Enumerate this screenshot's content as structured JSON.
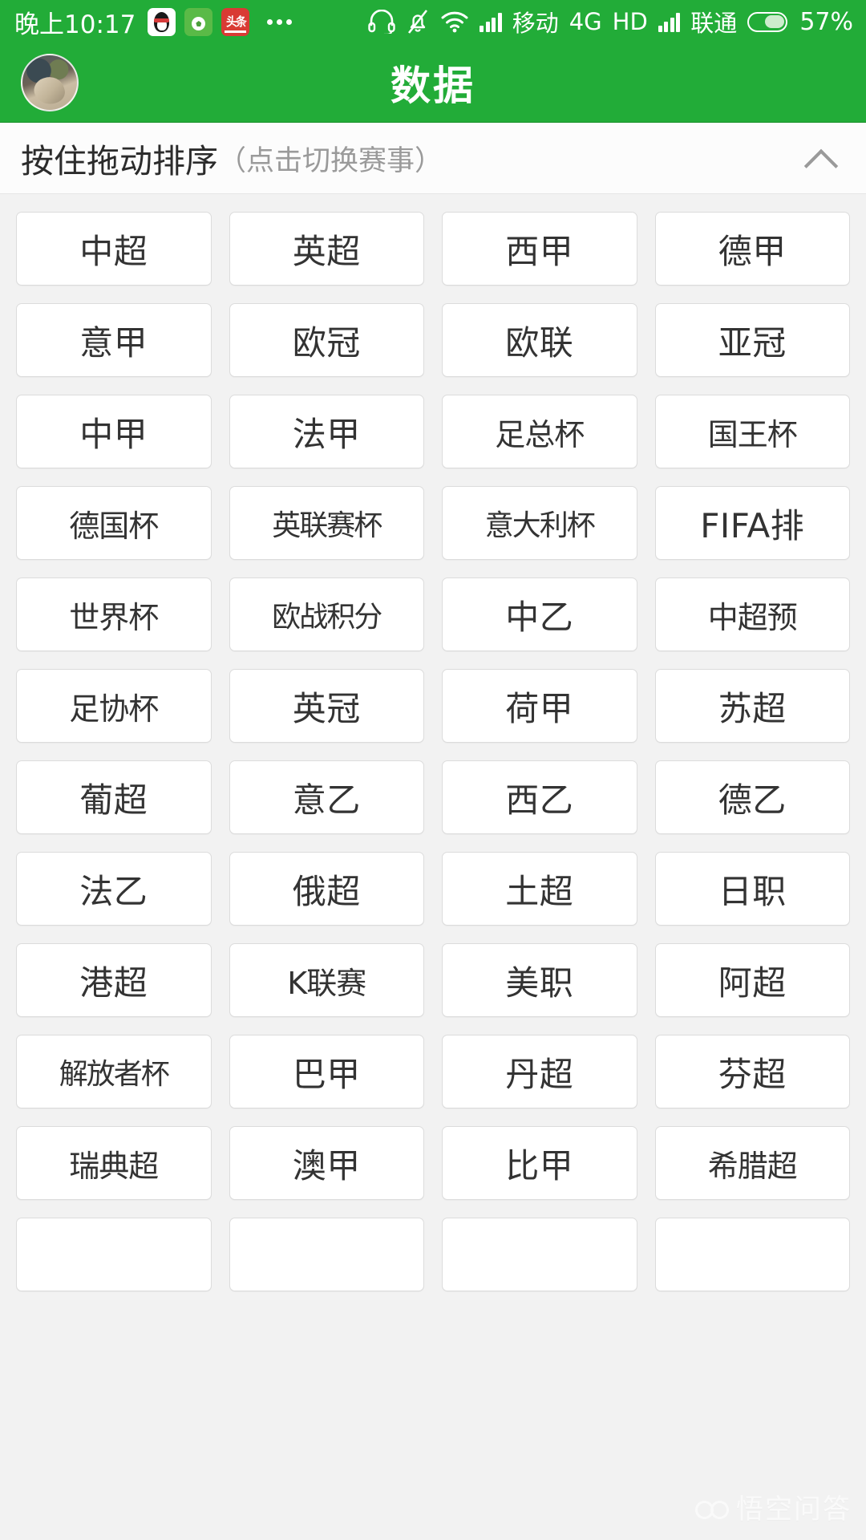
{
  "status_bar": {
    "time": "晚上10:17",
    "tray_icons": [
      "qq-icon",
      "soccer-app-icon",
      "toutiao-icon",
      "more-dots-icon"
    ],
    "right_icons": [
      "headset-icon",
      "bell-muted-icon",
      "wifi-icon",
      "signal-bars-icon"
    ],
    "carrier_1": "移动",
    "network": "4G",
    "hd": "HD",
    "carrier_2": "联通",
    "battery_percent": "57%",
    "battery_level": 57
  },
  "header": {
    "title": "数据",
    "avatar": "user-avatar",
    "background_color": "#22ac38"
  },
  "sort_bar": {
    "main_label": "按住拖动排序",
    "sub_label": "（点击切换赛事）",
    "collapse_icon": "chevron-up-icon"
  },
  "grid": {
    "columns": 4,
    "items": [
      "中超",
      "英超",
      "西甲",
      "德甲",
      "意甲",
      "欧冠",
      "欧联",
      "亚冠",
      "中甲",
      "法甲",
      "足总杯",
      "国王杯",
      "德国杯",
      "英联赛杯",
      "意大利杯",
      "FIFA排",
      "世界杯",
      "欧战积分",
      "中乙",
      "中超预",
      "足协杯",
      "英冠",
      "荷甲",
      "苏超",
      "葡超",
      "意乙",
      "西乙",
      "德乙",
      "法乙",
      "俄超",
      "土超",
      "日职",
      "港超",
      "K联赛",
      "美职",
      "阿超",
      "解放者杯",
      "巴甲",
      "丹超",
      "芬超",
      "瑞典超",
      "澳甲",
      "比甲",
      "希腊超",
      "",
      "",
      "",
      ""
    ]
  },
  "watermark": {
    "text": "悟空问答",
    "logo": "wukong-logo-icon"
  },
  "colors": {
    "brand_green": "#22ac38",
    "page_background": "#f2f2f2",
    "tile_background": "#ffffff",
    "tile_border": "#dcdcdc",
    "text_primary": "#333333",
    "text_muted": "#9a9a9a"
  }
}
